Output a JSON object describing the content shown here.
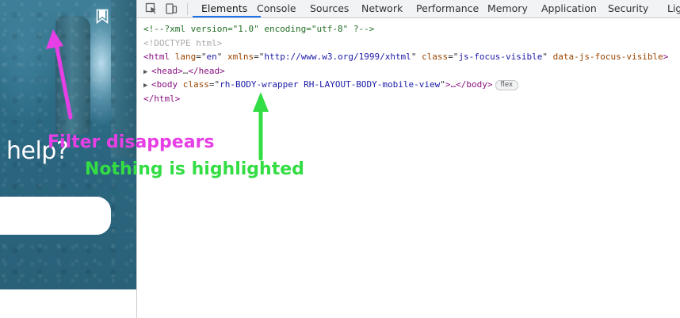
{
  "website": {
    "headline_fragment": "help?",
    "search_placeholder": ""
  },
  "devtools": {
    "tabs": [
      {
        "label": "Elements",
        "active": true
      },
      {
        "label": "Console",
        "active": false
      },
      {
        "label": "Sources",
        "active": false
      },
      {
        "label": "Network",
        "active": false
      },
      {
        "label": "Performance",
        "active": false
      },
      {
        "label": "Memory",
        "active": false
      },
      {
        "label": "Application",
        "active": false
      },
      {
        "label": "Security",
        "active": false
      },
      {
        "label": "Lig",
        "active": false
      }
    ],
    "toolbar_icons": [
      "inspect-element-icon",
      "device-toolbar-icon"
    ],
    "dom": {
      "xml_decl": "<!--?xml version=\"1.0\" encoding=\"utf-8\" ?-->",
      "doctype": "<!DOCTYPE html>",
      "html_open": {
        "tag": "html",
        "attrs": [
          {
            "name": "lang",
            "value": "en"
          },
          {
            "name": "xmlns",
            "value": "http://www.w3.org/1999/xhtml"
          },
          {
            "name": "class",
            "value": "js-focus-visible"
          },
          {
            "name": "data-js-focus-visible",
            "value": null
          }
        ]
      },
      "head_line": {
        "open": "<head>",
        "ellipsis": "…",
        "close": "</head>"
      },
      "body_line": {
        "open_tag": "body",
        "class_attr": "class",
        "class_value": "rh-BODY-wrapper RH-LAYOUT-BODY-mobile-view",
        "ellipsis": ">…",
        "close": "</body>",
        "badge": "flex"
      },
      "html_close": "</html>"
    }
  },
  "annotations": {
    "filter": {
      "text": "Filter disappears",
      "color": "#e63fe6"
    },
    "highlight": {
      "text": "Nothing is highlighted",
      "color": "#33dd44"
    }
  },
  "colors": {
    "active_tab_underline": "#1a73e8",
    "toolbar_bg": "#f1f3f4",
    "tag": "#881280",
    "attr_name": "#994500",
    "attr_value": "#1a1aa6",
    "comment": "#236e25"
  }
}
